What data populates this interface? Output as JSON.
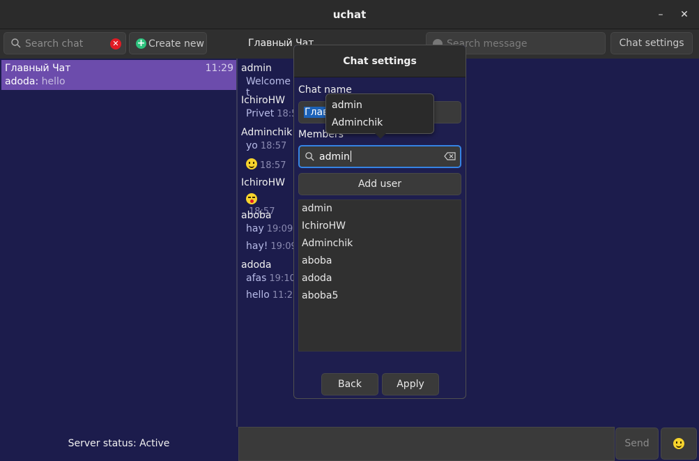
{
  "window": {
    "title": "uchat",
    "minimize_icon": "–",
    "close_icon": "✕"
  },
  "topbar": {
    "search_chat_placeholder": "Search chat",
    "clear_icon": "✕",
    "create_new_label": "Create new",
    "create_new_icon": "+",
    "chat_title": "Главный Чат",
    "search_message_placeholder": "Search message",
    "chat_settings_label": "Chat settings"
  },
  "sidebar": {
    "chats": [
      {
        "name": "Главный Чат",
        "time": "11:29",
        "last_author": "adoda:",
        "last_text": "hello"
      }
    ]
  },
  "messages": [
    {
      "author": "admin",
      "lines": [
        {
          "text": "Welcome t",
          "time": ""
        }
      ]
    },
    {
      "author": "IchiroHW",
      "lines": [
        {
          "text": "Privet",
          "time": "18:5"
        }
      ]
    },
    {
      "author": "Adminchik",
      "lines": [
        {
          "text": "yo",
          "time": "18:57"
        },
        {
          "emoji": "smile",
          "time": "18:57"
        }
      ]
    },
    {
      "author": "IchiroHW",
      "lines": [
        {
          "emoji": "wink",
          "time": "18:57"
        }
      ]
    },
    {
      "author": "aboba",
      "lines": [
        {
          "text": "hay",
          "time": "19:09"
        },
        {
          "text": "hay!",
          "time": "19:09"
        }
      ]
    },
    {
      "author": "adoda",
      "lines": [
        {
          "text": "afas",
          "time": "19:10"
        },
        {
          "text": "hello",
          "time": "11:2"
        }
      ]
    }
  ],
  "status": {
    "text": "Server status: Active"
  },
  "composer": {
    "send_label": "Send",
    "emoji_icon": "smile"
  },
  "dialog": {
    "title": "Chat settings",
    "chat_name_label": "Chat name",
    "chat_name_value": "Глав",
    "members_label": "Members",
    "member_search_value": "admin",
    "add_user_label": "Add user",
    "members": [
      "admin",
      "IchiroHW",
      "Adminchik",
      "aboba",
      "adoda",
      "aboba5"
    ],
    "back_label": "Back",
    "apply_label": "Apply"
  },
  "autocomplete": {
    "options": [
      "admin",
      "Adminchik"
    ]
  },
  "colors": {
    "selected_chat": "#6c4cac",
    "background": "#1c1c4c",
    "accent": "#3584e4",
    "danger": "#e01b24",
    "success": "#2ec27e"
  }
}
